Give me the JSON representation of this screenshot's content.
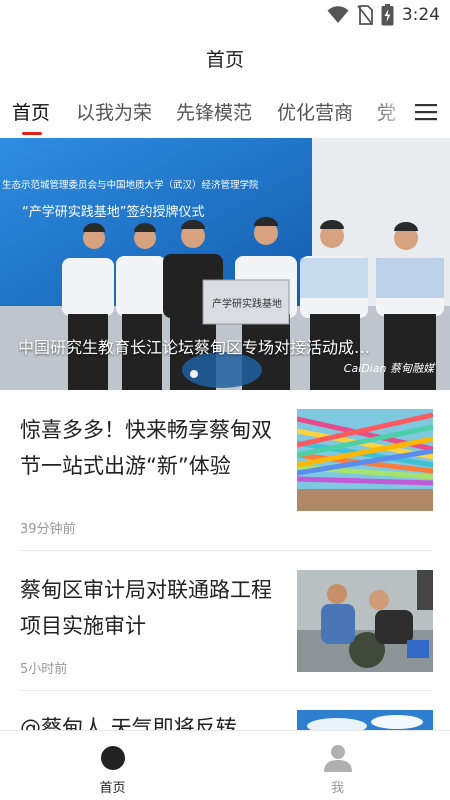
{
  "status_bar": {
    "time": "3:24",
    "icons": [
      "wifi-icon",
      "no-sim-icon",
      "battery-charging-icon"
    ]
  },
  "header": {
    "title": "首页"
  },
  "tabs": [
    {
      "label": "首页",
      "active": true
    },
    {
      "label": "以我为荣",
      "active": false
    },
    {
      "label": "先锋模范",
      "active": false
    },
    {
      "label": "优化营商",
      "active": false
    },
    {
      "label": "党",
      "active": false
    }
  ],
  "menu_icon": "hamburger-menu-icon",
  "banner": {
    "caption": "中国研究生教育长江论坛蔡甸区专场对接活动成…",
    "backdrop_line1": "生态示范城管理委员会与中国地质大学（武汉）经济管理学院",
    "backdrop_line2": "“产学研实践基地”签约授牌仪式",
    "plaque_text": "产学研实践基地",
    "watermark": "CaiDian 蔡甸融媒"
  },
  "news": [
    {
      "title": "惊喜多多！快来畅享蔡甸双节一站式出游“新”体验",
      "time": "39分钟前"
    },
    {
      "title": "蔡甸区审计局对联通路工程项目实施审计",
      "time": "5小时前"
    },
    {
      "title": "@蔡甸人 天气即将反转",
      "time": ""
    }
  ],
  "bottom_nav": [
    {
      "label": "首页",
      "icon": "home-circle-icon",
      "active": true
    },
    {
      "label": "我",
      "icon": "user-profile-icon",
      "active": false
    }
  ],
  "colors": {
    "accent": "#e02020",
    "nav_active": "#222222",
    "nav_inactive": "#b0b0b0"
  }
}
